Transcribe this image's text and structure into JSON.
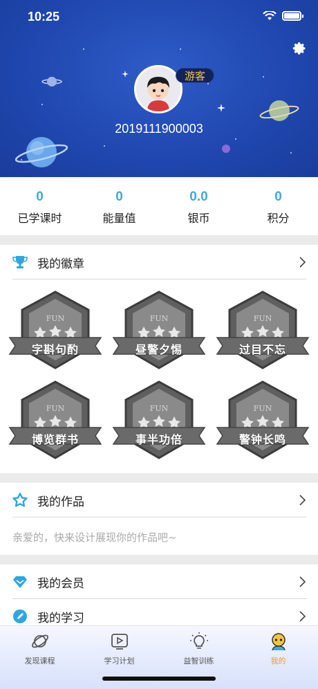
{
  "status_bar": {
    "time": "10:25"
  },
  "profile": {
    "badge": "游客",
    "user_id": "2019111900003"
  },
  "stats": [
    {
      "value": "0",
      "label": "已学课时"
    },
    {
      "value": "0",
      "label": "能量值"
    },
    {
      "value": "0.0",
      "label": "银币"
    },
    {
      "value": "0",
      "label": "积分"
    }
  ],
  "badges_section": {
    "title": "我的徽章",
    "badge_emblem": "FUN",
    "items": [
      "字斟句酌",
      "昼警夕惕",
      "过目不忘",
      "博览群书",
      "事半功倍",
      "警钟长鸣"
    ]
  },
  "works_section": {
    "title": "我的作品",
    "hint": "亲爱的，快来设计展现你的作品吧~"
  },
  "menu": [
    {
      "title": "我的会员",
      "icon": "diamond-icon"
    },
    {
      "title": "我的学习",
      "icon": "pencil-icon"
    }
  ],
  "tabbar": [
    {
      "label": "发现课程",
      "icon": "planet-icon"
    },
    {
      "label": "学习计划",
      "icon": "play-icon"
    },
    {
      "label": "益智训练",
      "icon": "bulb-icon"
    },
    {
      "label": "我的",
      "icon": "me-icon",
      "active": true
    }
  ],
  "colors": {
    "header_blue": "#2048b0",
    "accent_blue": "#3fa8e0",
    "active_orange": "#f29a1f",
    "guest_gold": "#f4c54a"
  }
}
